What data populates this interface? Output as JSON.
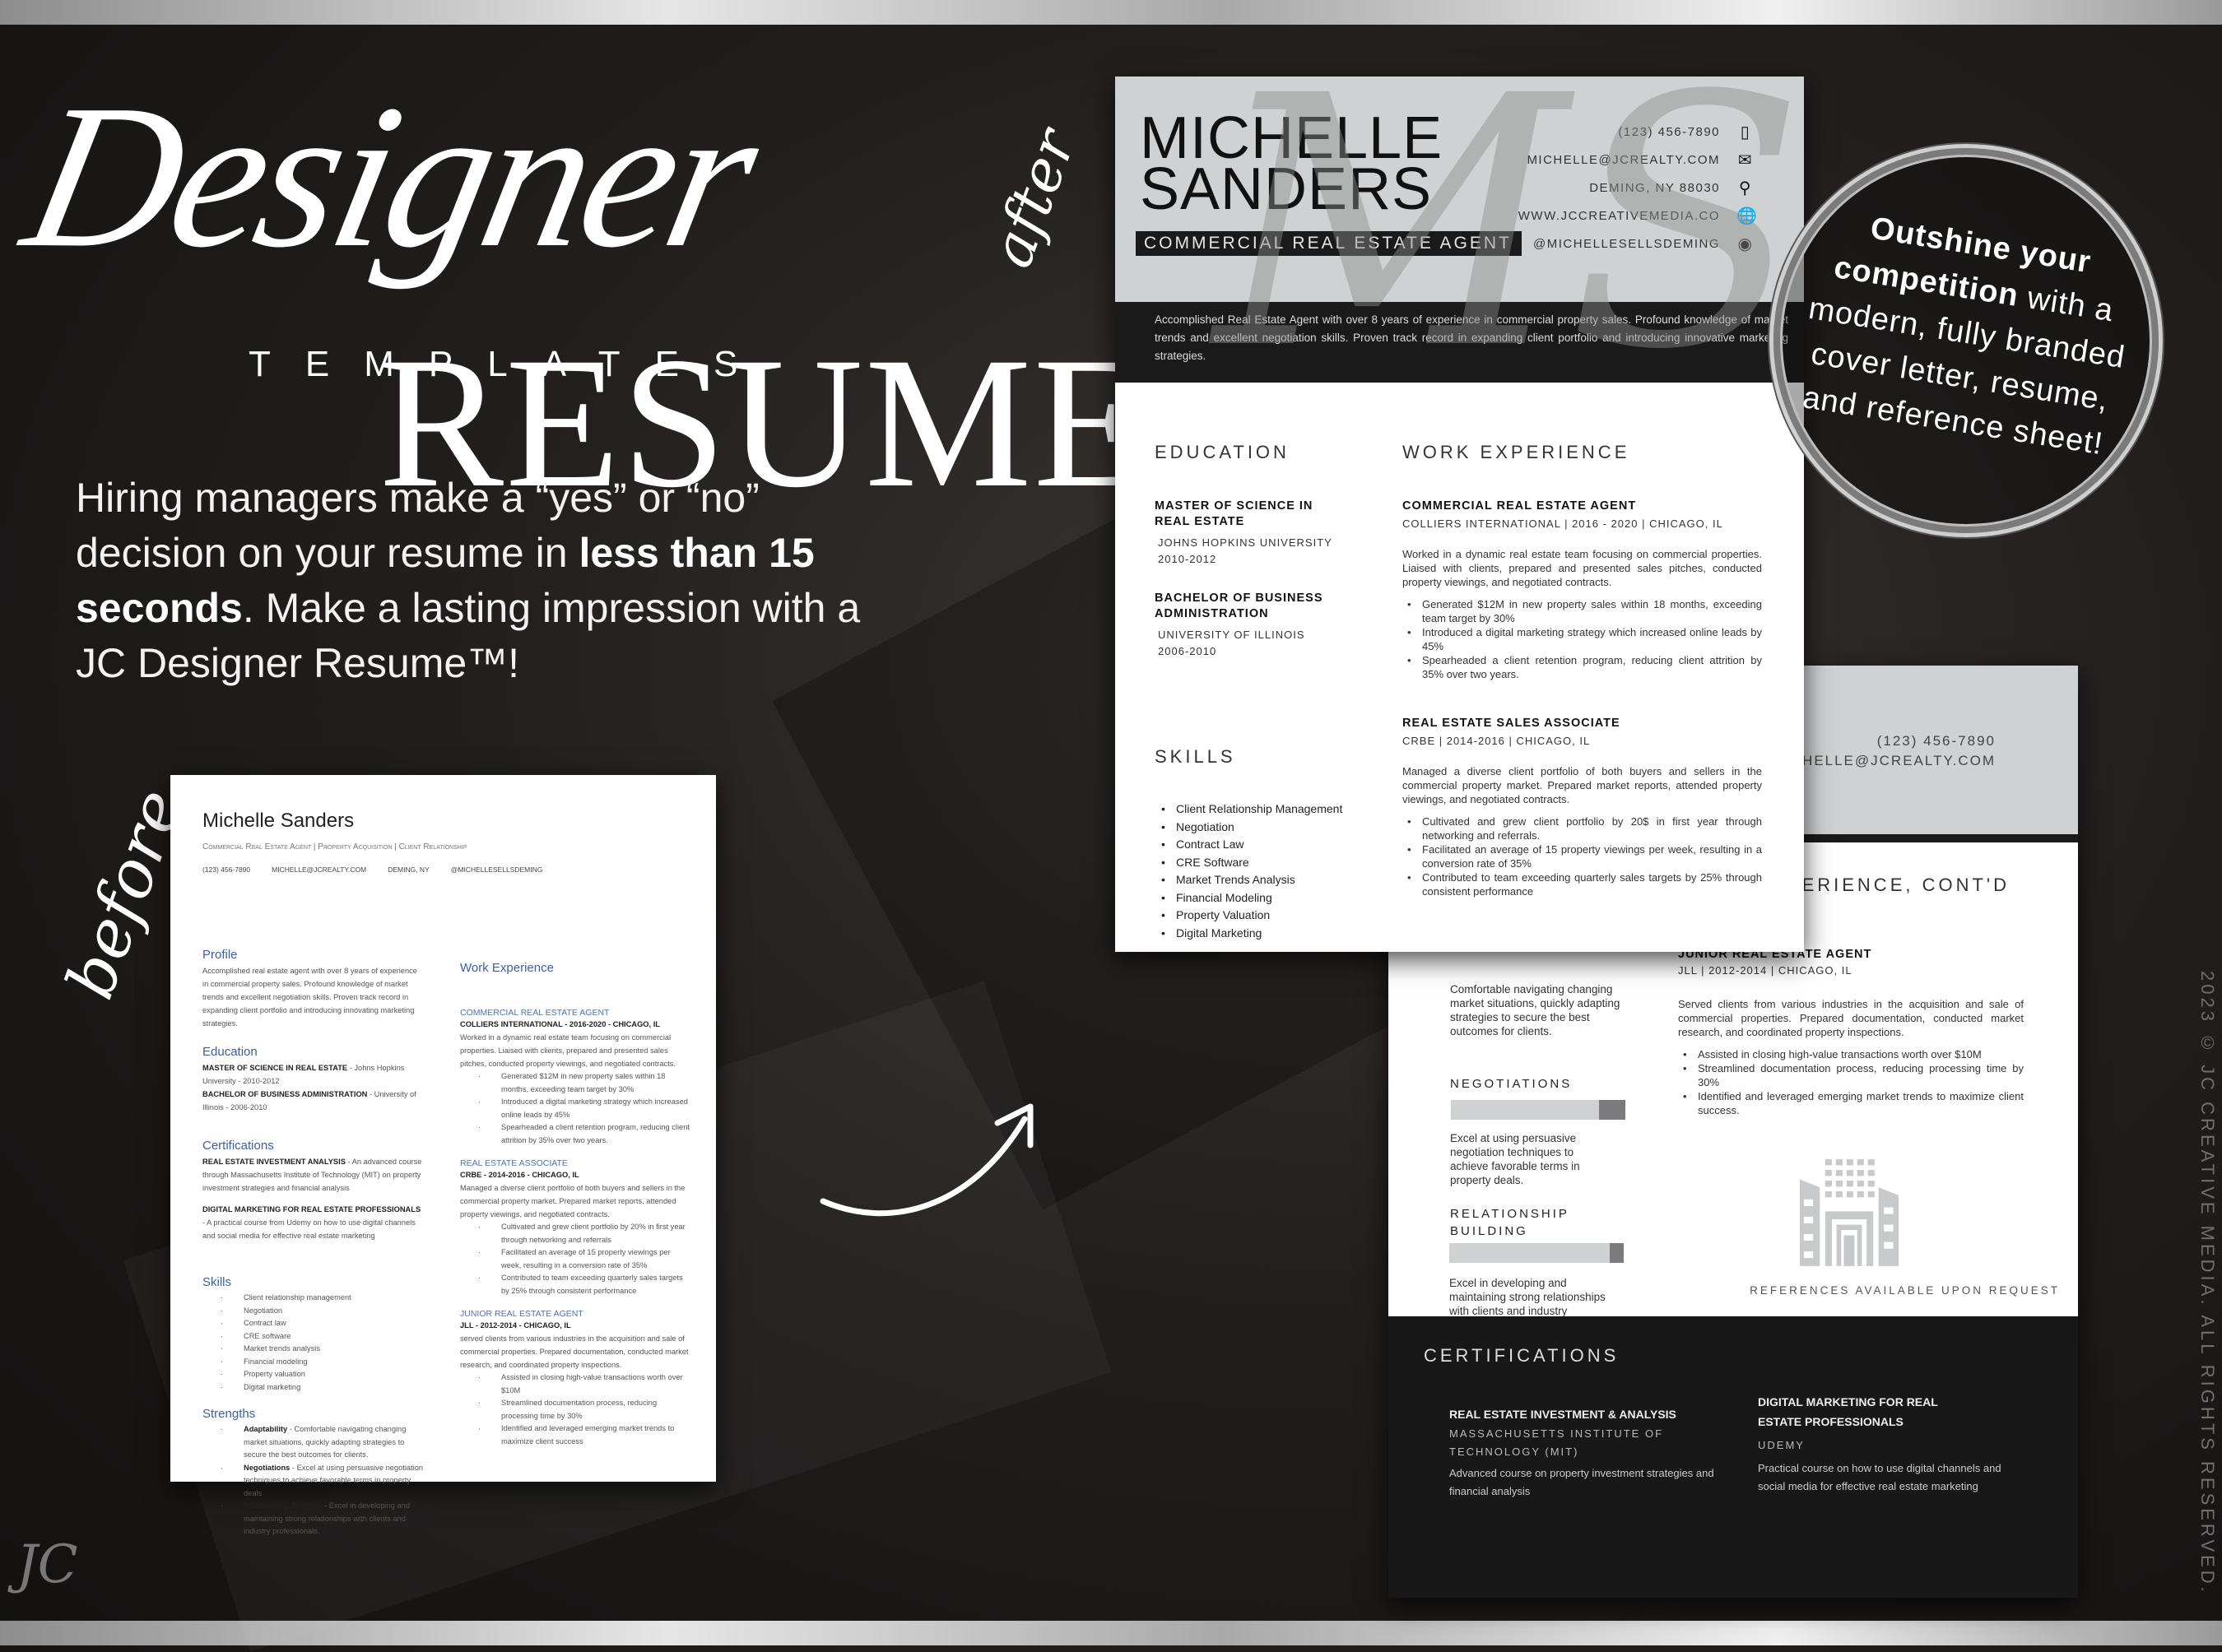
{
  "hero": {
    "script_word": "Designer",
    "main_word": "RESUME",
    "trademark": "™",
    "sub_word": "TEMPLATES",
    "pitch_part1": "Hiring managers make a “yes” or “no” decision on your resume in ",
    "pitch_bold1": "less than 15 seconds",
    "pitch_part2": ". Make a lasting impression with a JC Designer Resume™!",
    "after_label": "after",
    "before_label": "before",
    "logo": "JC"
  },
  "badge": {
    "bold": "Outshine your competition",
    "rest": " with a modern, fully branded cover letter, resume, and reference sheet!"
  },
  "copyright": "2023 © JC CREATIVE MEDIA. ALL RIGHTS RESERVED.",
  "colors": {
    "header_gray": "#cfd1d2",
    "dark": "#1a1a1a",
    "link_blue": "#3b5ea8"
  },
  "after_resume": {
    "first_name": "MICHELLE",
    "last_name": "SANDERS",
    "title": "COMMERCIAL REAL ESTATE AGENT",
    "monogram": "MS",
    "contacts": [
      {
        "text": "(123) 456-7890",
        "icon": "phone-icon"
      },
      {
        "text": "MICHELLE@JCREALTY.COM",
        "icon": "envelope-icon"
      },
      {
        "text": "DEMING, NY  88030",
        "icon": "map-pin-icon"
      },
      {
        "text": "WWW.JCCREATIVEMEDIA.CO",
        "icon": "globe-icon"
      },
      {
        "text": "@MICHELLESELLSDEMING",
        "icon": "user-circle-icon"
      }
    ],
    "summary": "Accomplished Real Estate Agent with over 8 years of experience in commercial property sales. Profound knowledge of market trends and excellent negotiation skills. Proven track record in expanding client portfolio and introducing innovative marketing strategies.",
    "education_heading": "EDUCATION",
    "education": [
      {
        "degree": "MASTER OF SCIENCE IN REAL ESTATE",
        "school": "JOHNS HOPKINS UNIVERSITY",
        "years": "2010-2012"
      },
      {
        "degree": "BACHELOR OF BUSINESS ADMINISTRATION",
        "school": "UNIVERSITY OF ILLINOIS",
        "years": "2006-2010"
      }
    ],
    "skills_heading": "SKILLS",
    "skills": [
      "Client Relationship Management",
      "Negotiation",
      "Contract Law",
      "CRE Software",
      "Market Trends Analysis",
      "Financial Modeling",
      "Property Valuation",
      "Digital Marketing"
    ],
    "work_heading": "WORK EXPERIENCE",
    "jobs": [
      {
        "title": "COMMERCIAL REAL ESTATE AGENT",
        "meta": "COLLIERS INTERNATIONAL  |  2016 - 2020  |  CHICAGO, IL",
        "desc": "Worked in a dynamic real estate team focusing on commercial properties. Liaised with clients, prepared and presented sales pitches, conducted property viewings, and negotiated contracts.",
        "bullets": [
          "Generated $12M in new property sales within 18 months, exceeding team target by 30%",
          "Introduced a digital marketing strategy which increased online leads by 45%",
          "Spearheaded a client retention program, reducing client attrition by 35% over two years."
        ]
      },
      {
        "title": "REAL ESTATE SALES ASSOCIATE",
        "meta": "CRBE  |  2014-2016  |  CHICAGO, IL",
        "desc": "Managed a diverse client portfolio of both buyers and sellers in the commercial property market. Prepared market reports, attended property viewings, and negotiated contracts.",
        "bullets": [
          "Cultivated and grew client portfolio by 20$ in first year through networking and referrals.",
          "Facilitated an average of 15 property viewings per week, resulting in a conversion rate of 35%",
          "Contributed to team exceeding quarterly sales targets by 25% through consistent performance"
        ]
      }
    ]
  },
  "second_page": {
    "phone": "(123) 456-7890",
    "email": "MICHELLE@JCREALTY.COM",
    "work_heading": "WORK EXPERIENCE, CONT'D",
    "job_title": "JUNIOR REAL ESTATE AGENT",
    "job_meta": "JLL  |  2012-2014  |  CHICAGO, IL",
    "job_desc": "Served clients from various industries in the acquisition and sale of commercial properties. Prepared documentation, conducted market research, and coordinated property inspections.",
    "job_bullets": [
      "Assisted in closing high-value transactions worth over $10M",
      "Streamlined documentation process, reducing processing time by 30%",
      "Identified and leveraged emerging market trends to maximize client success."
    ],
    "adaptability_text": "Comfortable navigating changing market situations, quickly adapting strategies to secure the best outcomes for clients.",
    "strengths": [
      {
        "name": "NEGOTIATIONS",
        "level": 0.85,
        "desc": "Excel at using persuasive negotiation techniques to achieve favorable terms in property deals."
      },
      {
        "name": "RELATIONSHIP BUILDING",
        "level": 0.92,
        "desc": "Excel in developing and maintaining strong relationships with clients and industry professionals."
      }
    ],
    "references": "REFERENCES AVAILABLE UPON REQUEST",
    "cert_heading": "CERTIFICATIONS",
    "certs": [
      {
        "title": "REAL ESTATE INVESTMENT & ANALYSIS",
        "org": "MASSACHUSETTS INSTITUTE OF TECHNOLOGY (MIT)",
        "desc": "Advanced course on property investment strategies and financial analysis"
      },
      {
        "title": "DIGITAL MARKETING FOR REAL ESTATE PROFESSIONALS",
        "org": "UDEMY",
        "desc": "Practical course on how to use digital channels and social media for effective real estate marketing"
      }
    ]
  },
  "before_resume": {
    "name": "Michelle Sanders",
    "subtitle": "Commercial Real Estate Agent | Property Acquisition | Client Relationship",
    "contacts": [
      "(123) 456-7890",
      "MICHELLE@JCREALTY.COM",
      "DEMING, NY",
      "@MICHELLESELLSDEMING"
    ],
    "profile_heading": "Profile",
    "profile": "Accomplished real estate agent with over 8 years of experience in commercial property sales. Profound knowledge of market trends and excellent negotiation skills. Proven track record in expanding client portfolio and introducing innovating marketing strategies.",
    "education_heading": "Education",
    "education": [
      {
        "bold": "MASTER OF SCIENCE IN REAL ESTATE",
        "rest": " - Johns Hopkins University - 2010-2012"
      },
      {
        "bold": "BACHELOR OF BUSINESS ADMINISTRATION",
        "rest": " - University of Illinois - 2006-2010"
      }
    ],
    "cert_heading": "Certifications",
    "certs": [
      {
        "bold": "REAL ESTATE INVESTMENT ANALYSIS",
        "rest": " - An advanced course through Massachusetts Institute of Technology (MIT) on property investment strategies and financial analysis"
      },
      {
        "bold": "DIGITAL MARKETING FOR REAL ESTATE PROFESSIONALS",
        "rest": " - A practical course from Udemy on how to use digital channels and social media for effective real estate marketing"
      }
    ],
    "skills_heading": "Skills",
    "skills": [
      "Client relationship management",
      "Negotiation",
      "Contract law",
      "CRE software",
      "Market trends analysis",
      "Financial modeling",
      "Property valuation",
      "Digital marketing"
    ],
    "strengths_heading": "Strengths",
    "strengths": [
      {
        "bold": "Adaptability",
        "rest": " - Comfortable navigating changing market situations, quickly adapting strategies to secure the best outcomes for clients."
      },
      {
        "bold": "Negotiations",
        "rest": " - Excel at using persuasive negotiation techniques to achieve favorable terms in property deals"
      },
      {
        "bold": "Relationship Building",
        "rest": " - Excel in developing and maintaining strong relationships with clients and industry professionals."
      }
    ],
    "work_heading": "Work Experience",
    "jobs": [
      {
        "title": "COMMERCIAL REAL ESTATE AGENT",
        "meta": "COLLIERS INTERNATIONAL - 2016-2020 - CHICAGO, IL",
        "desc": "Worked in a dynamic real estate team focusing on commercial properties. Liaised with clients, prepared and presented sales pitches, conducted property viewings, and negotiated contracts.",
        "bullets": [
          "Generated $12M in new property sales within 18 months, exceeding team target by 30%",
          "Introduced a digital marketing strategy which increased online leads by 45%",
          "Spearheaded a client retention program, reducing client attrition by 35% over two years."
        ]
      },
      {
        "title": "REAL ESTATE ASSOCIATE",
        "meta": "CRBE - 2014-2016 - CHICAGO, IL",
        "desc": "Managed a diverse client portfolio of both buyers and sellers in the commercial property market. Prepared market reports, attended property viewings, and negotiated contracts.",
        "bullets": [
          "Cultivated and grew client portfolio by 20% in first year through networking and referrals",
          "Facilitated an average of 15 property viewings per week, resulting in a conversion rate of 35%",
          "Contributed to team exceeding quarterly sales targets by 25% through consistent performance"
        ]
      },
      {
        "title": "JUNIOR REAL ESTATE AGENT",
        "meta": "JLL - 2012-2014 - CHICAGO, IL",
        "desc": "served clients from various industries in the acquisition and sale of commercial properties. Prepared documentation, conducted market research, and coordinated property inspections.",
        "bullets": [
          "Assisted in closing high-value transactions worth over $10M",
          "Streamlined documentation process, reducing processing time by 30%",
          "Identified and leveraged emerging market trends to maximize client success"
        ]
      }
    ]
  }
}
